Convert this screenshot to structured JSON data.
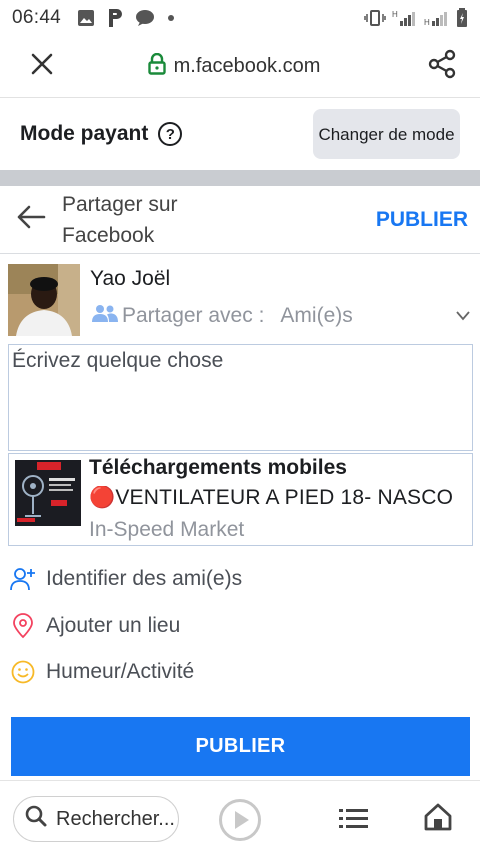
{
  "status_bar": {
    "time": "06:44",
    "icons": [
      "image-icon",
      "p-app-icon",
      "chat-icon",
      "dot-icon",
      "vibrate-icon",
      "signal-icon",
      "signal-icon",
      "battery-icon"
    ],
    "net_label_1": "H",
    "net_label_2": "H"
  },
  "browser": {
    "url": "m.facebook.com",
    "close_icon": "close-icon",
    "lock_icon": "lock-icon",
    "share_icon": "share-icon",
    "lock_color": "#1a8a3a"
  },
  "mode_bar": {
    "label": "Mode payant",
    "help_glyph": "?",
    "change_label": "Changer de mode"
  },
  "composer": {
    "title": "Partager sur Facebook",
    "publish_link": "PUBLIER",
    "accent": "#1877f2"
  },
  "user": {
    "name": "Yao Joël",
    "share_with_label": "Partager avec :",
    "audience": "Ami(e)s"
  },
  "post": {
    "placeholder": "Écrivez quelque chose"
  },
  "link_preview": {
    "title": "Téléchargements mobiles",
    "description": "🔴VENTILATEUR A PIED 18- NASCO",
    "source": "In-Speed Market"
  },
  "actions": [
    {
      "label": "Identifier des ami(e)s",
      "icon": "tag-friends-icon",
      "color": "#1877f2"
    },
    {
      "label": "Ajouter un lieu",
      "icon": "location-pin-icon",
      "color": "#f3425f"
    },
    {
      "label": "Humeur/Activité",
      "icon": "smiley-icon",
      "color": "#f7b928"
    }
  ],
  "publish_button": "PUBLIER",
  "bottom_bar": {
    "search_placeholder": "Rechercher...",
    "play_icon": "play-icon",
    "list_icon": "list-icon",
    "home_icon": "home-icon"
  }
}
